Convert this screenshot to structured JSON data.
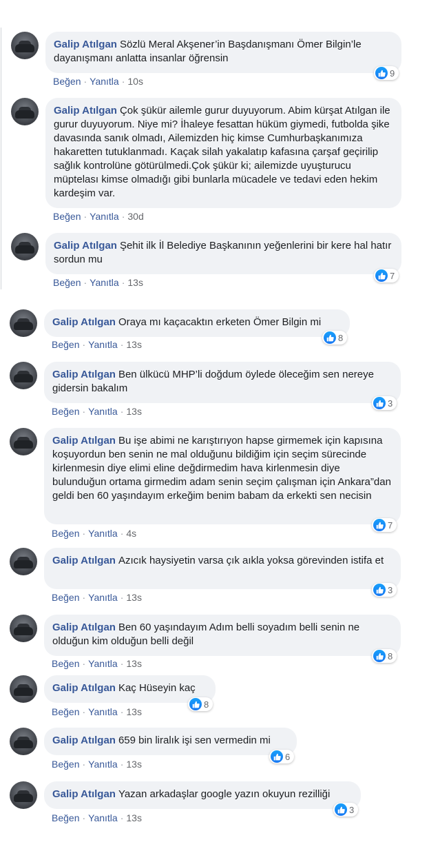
{
  "colors": {
    "author": "#385898",
    "bubble": "#f0f2f5",
    "like": "#1877f2",
    "meta": "#65676b"
  },
  "actions": {
    "like_label": "Beğen",
    "reply_label": "Yanıtla"
  },
  "icons": {
    "like": "thumbs-up-icon",
    "avatar": "user-avatar"
  },
  "comments": [
    {
      "author": "Galip Atılgan",
      "text": "Sözlü Meral Akşener’in Başdanışmanı Ömer Bilgin’le dayanışmanı anlatta insanlar öğrensin",
      "time": "10s",
      "likes": "9"
    },
    {
      "author": "Galip Atılgan",
      "text": "Çok şükür ailemle gurur duyuyorum. Abim kürşat Atılgan ile gurur duyuyorum. Niye mi? İhaleye fesattan hüküm giymedi, futbolda şike davasında sanık olmadı, Ailemizden hiç kimse Cumhurbaşkanımıza hakaretten tutuklanmadı. Kaçak silah yakalatıp kafasına çarşaf geçirilip sağlık kontrolüne götürülmedi.Çok şükür ki; ailemizde uyuşturucu müptelası kimse olmadığı gibi bunlarla mücadele ve tedavi eden hekim kardeşim var.",
      "time": "30d",
      "likes": ""
    },
    {
      "author": "Galip Atılgan",
      "text": "Şehit ilk İl Belediye Başkanının yeğenlerini bir kere hal hatır sordun mu",
      "time": "13s",
      "likes": "7"
    },
    {
      "author": "Galip Atılgan",
      "text": "Oraya mı kaçacaktın erketen Ömer Bilgin mi",
      "time": "13s",
      "likes": "8"
    },
    {
      "author": "Galip Atılgan",
      "text": "Ben ülkücü MHP’li doğdum öylede öleceğim sen nereye gidersin bakalım",
      "time": "13s",
      "likes": "3"
    },
    {
      "author": "Galip Atılgan",
      "text": "Bu işe abimi ne karıştırıyon hapse girmemek için kapısına koşuyordun ben senin ne mal olduğunu bildiğim için seçim sürecinde kirlenmesin diye elimi eline değdirmedim hava kirlenmesin diye bulunduğun ortama girmedim adam senin seçim çalışman için Ankara”dan geldi ben 60 yaşındayım erkeğim benim babam da erkekti sen necisin",
      "time": "4s",
      "likes": "7"
    },
    {
      "author": "Galip Atılgan",
      "text": "Azıcık haysiyetin varsa çık aıkla yoksa görevinden istifa et",
      "time": "13s",
      "likes": "3"
    },
    {
      "author": "Galip Atılgan",
      "text": "Ben 60 yaşındayım Adım belli soyadım belli senin ne olduğun kim olduğun belli değil",
      "time": "13s",
      "likes": "8"
    },
    {
      "author": "Galip Atılgan",
      "text": "Kaç Hüseyin kaç",
      "time": "13s",
      "likes": "8"
    },
    {
      "author": "Galip Atılgan",
      "text": "659 bin liralık işi sen vermedin mi",
      "time": "13s",
      "likes": "6"
    },
    {
      "author": "Galip Atılgan",
      "text": "Yazan arkadaşlar google yazın okuyun rezilliği",
      "time": "13s",
      "likes": "3"
    }
  ]
}
